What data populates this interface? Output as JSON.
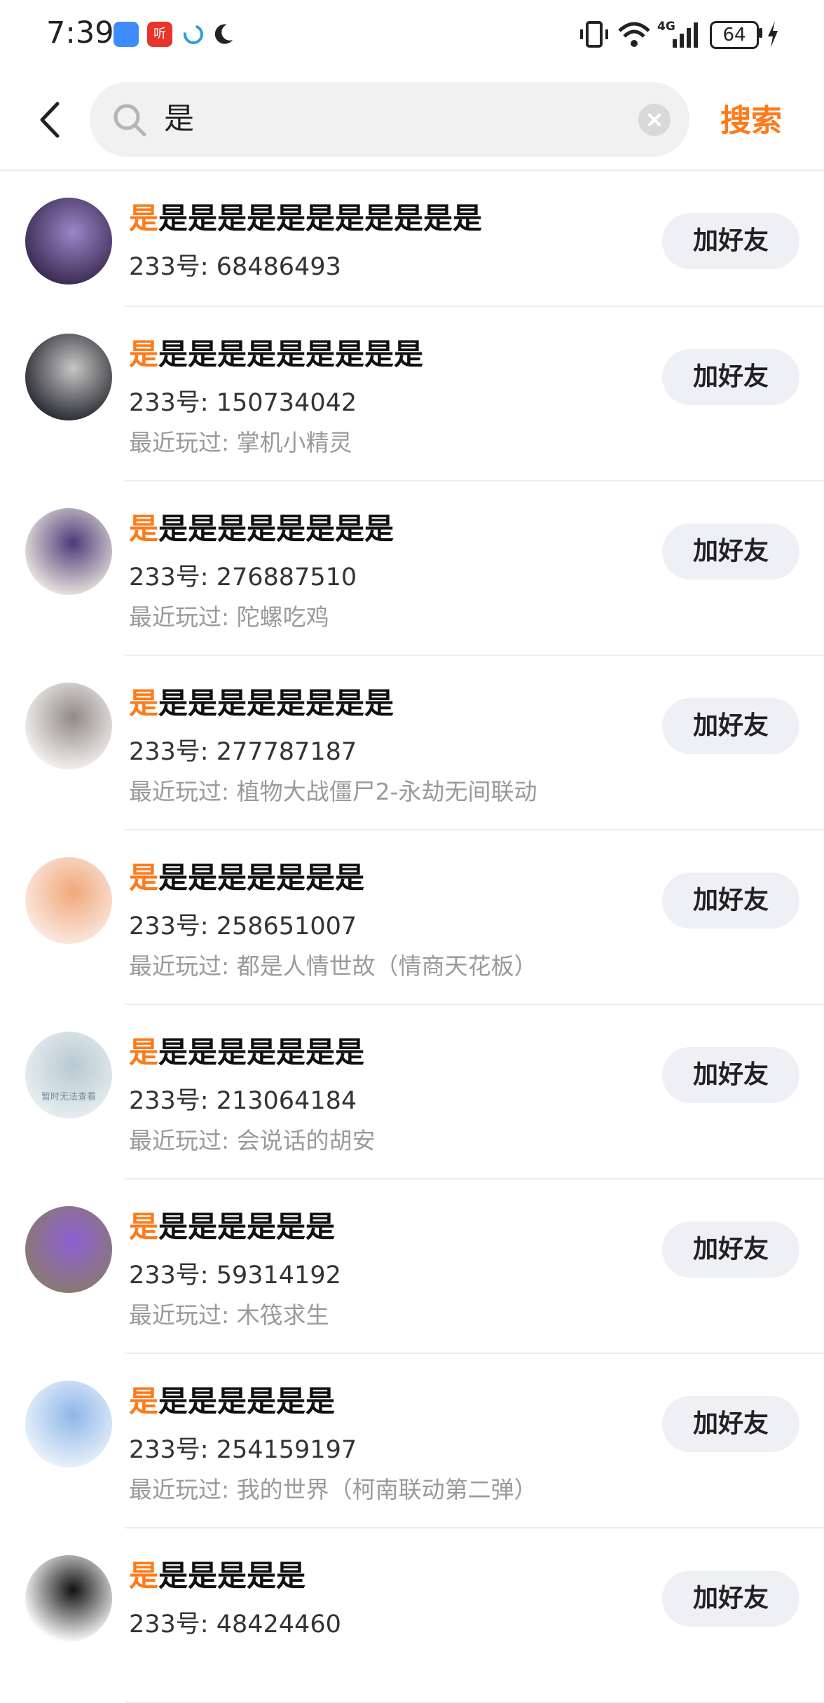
{
  "status_bar": {
    "time": "7:39",
    "notif_app_label": "听",
    "battery": "64",
    "network": "4G",
    "icons": [
      "cloud-icon",
      "app-icon",
      "swirl-icon",
      "moon-icon",
      "vibrate-icon",
      "wifi-icon",
      "signal-icon",
      "battery-icon",
      "charging-icon"
    ]
  },
  "search": {
    "query": "是",
    "button_label": "搜索"
  },
  "results": [
    {
      "highlight": "是",
      "rest": "是是是是是是是是是是是",
      "uid": "233号: 68486493",
      "recent": "",
      "button": "加好友",
      "avatar_colors": [
        "#3b2b52",
        "#9a86c8"
      ]
    },
    {
      "highlight": "是",
      "rest": "是是是是是是是是是",
      "uid": "233号: 150734042",
      "recent": "最近玩过: 掌机小精灵",
      "button": "加好友",
      "avatar_colors": [
        "#2a2d35",
        "#c9c6c5"
      ]
    },
    {
      "highlight": "是",
      "rest": "是是是是是是是是",
      "uid": "233号: 276887510",
      "recent": "最近玩过: 陀螺吃鸡",
      "button": "加好友",
      "avatar_colors": [
        "#e8e3dc",
        "#4b3a7a"
      ]
    },
    {
      "highlight": "是",
      "rest": "是是是是是是是是",
      "uid": "233号: 277787187",
      "recent": "最近玩过: 植物大战僵尸2-永劫无间联动",
      "button": "加好友",
      "avatar_colors": [
        "#f4f0ee",
        "#8f8a88"
      ]
    },
    {
      "highlight": "是",
      "rest": "是是是是是是是",
      "uid": "233号: 258651007",
      "recent": "最近玩过: 都是人情世故（情商天花板）",
      "button": "加好友",
      "avatar_colors": [
        "#fbe8e0",
        "#f0a87a"
      ]
    },
    {
      "highlight": "是",
      "rest": "是是是是是是是",
      "uid": "233号: 213064184",
      "recent": "最近玩过: 会说话的胡安",
      "button": "加好友",
      "avatar_colors": [
        "#e7eef1",
        "#b9c9d1"
      ],
      "avatar_caption": "暂时无法查看"
    },
    {
      "highlight": "是",
      "rest": "是是是是是是",
      "uid": "233号: 59314192",
      "recent": "最近玩过: 木筏求生",
      "button": "加好友",
      "avatar_colors": [
        "#8a7a72",
        "#8c5fd1"
      ]
    },
    {
      "highlight": "是",
      "rest": "是是是是是是",
      "uid": "233号: 254159197",
      "recent": "最近玩过: 我的世界（柯南联动第二弹）",
      "button": "加好友",
      "avatar_colors": [
        "#e9f2fb",
        "#8fb6e8"
      ]
    },
    {
      "highlight": "是",
      "rest": "是是是是是",
      "uid": "233号: 48424460",
      "recent": "",
      "button": "加好友",
      "avatar_colors": [
        "#ffffff",
        "#111111"
      ]
    }
  ],
  "colors": {
    "accent": "#ff7a1a",
    "button_bg": "#eef0f6",
    "secondary_text": "#9a9a9a"
  }
}
